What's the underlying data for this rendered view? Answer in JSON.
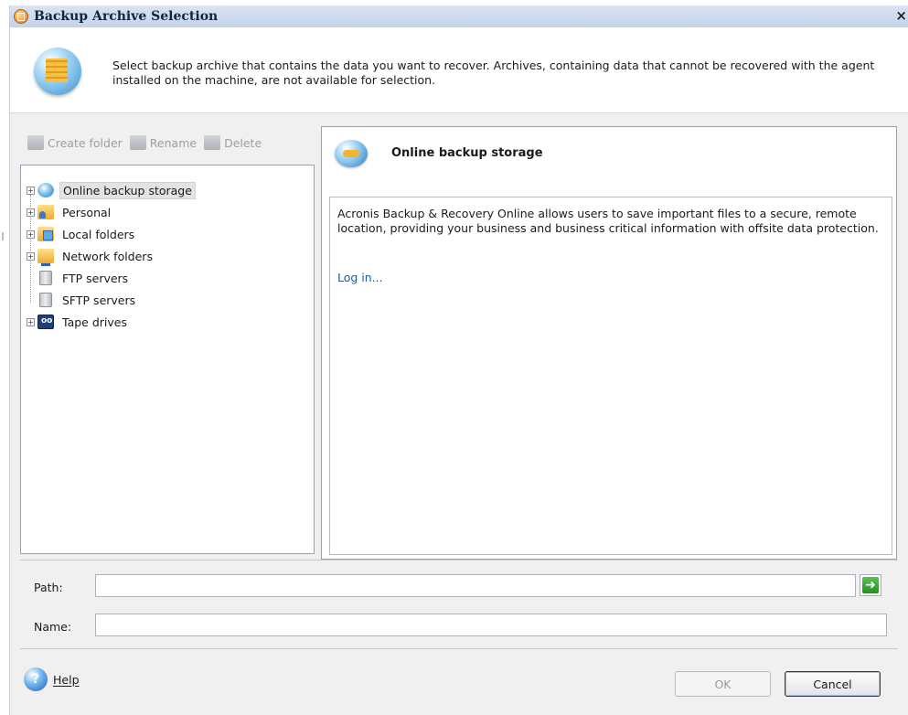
{
  "window": {
    "title": "Backup Archive Selection",
    "close_glyph": "×"
  },
  "header": {
    "icon": "archive-globe-icon",
    "text": "Select backup archive that contains the data you want to recover. Archives, containing data that cannot be recovered with the agent installed on the machine, are not available for selection."
  },
  "toolbar": {
    "create_folder": "Create folder",
    "rename": "Rename",
    "delete": "Delete"
  },
  "tree": {
    "items": [
      {
        "label": "Online backup storage",
        "icon": "online-storage-icon",
        "expandable": true,
        "selected": true
      },
      {
        "label": "Personal",
        "icon": "personal-folder-icon",
        "expandable": true
      },
      {
        "label": "Local folders",
        "icon": "local-folder-icon",
        "expandable": true
      },
      {
        "label": "Network folders",
        "icon": "network-folder-icon",
        "expandable": true
      },
      {
        "label": "FTP servers",
        "icon": "server-icon",
        "expandable": false
      },
      {
        "label": "SFTP servers",
        "icon": "server-icon",
        "expandable": false
      },
      {
        "label": "Tape drives",
        "icon": "tape-drive-icon",
        "expandable": true
      }
    ]
  },
  "details": {
    "title": "Online backup storage",
    "description": "Acronis Backup & Recovery Online allows users to save important files to a secure, remote location, providing your business and business critical information with offsite data protection.",
    "link": "Log in..."
  },
  "form": {
    "path_label": "Path:",
    "path_value": "",
    "name_label": "Name:",
    "name_value": "",
    "go_glyph": "➜"
  },
  "footer": {
    "help_glyph": "?",
    "help_label": "Help",
    "ok_label": "OK",
    "cancel_label": "Cancel"
  }
}
